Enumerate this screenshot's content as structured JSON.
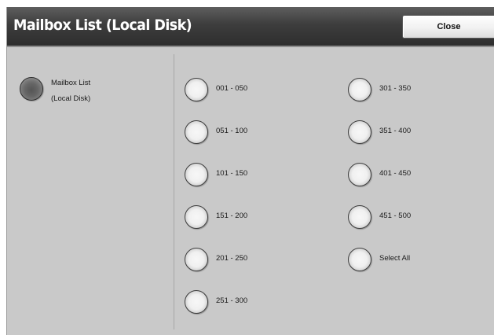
{
  "header": {
    "title": "Mailbox List (Local Disk)",
    "close_label": "Close"
  },
  "left_option": {
    "label_line1": "Mailbox List",
    "label_line2": "(Local Disk)",
    "selected": true
  },
  "ranges_col1": [
    {
      "label": "001 - 050"
    },
    {
      "label": "051 - 100"
    },
    {
      "label": "101 - 150"
    },
    {
      "label": "151 - 200"
    },
    {
      "label": "201 - 250"
    },
    {
      "label": "251 - 300"
    }
  ],
  "ranges_col2": [
    {
      "label": "301 - 350"
    },
    {
      "label": "351 - 400"
    },
    {
      "label": "401 - 450"
    },
    {
      "label": "451 - 500"
    },
    {
      "label": "Select All"
    }
  ]
}
